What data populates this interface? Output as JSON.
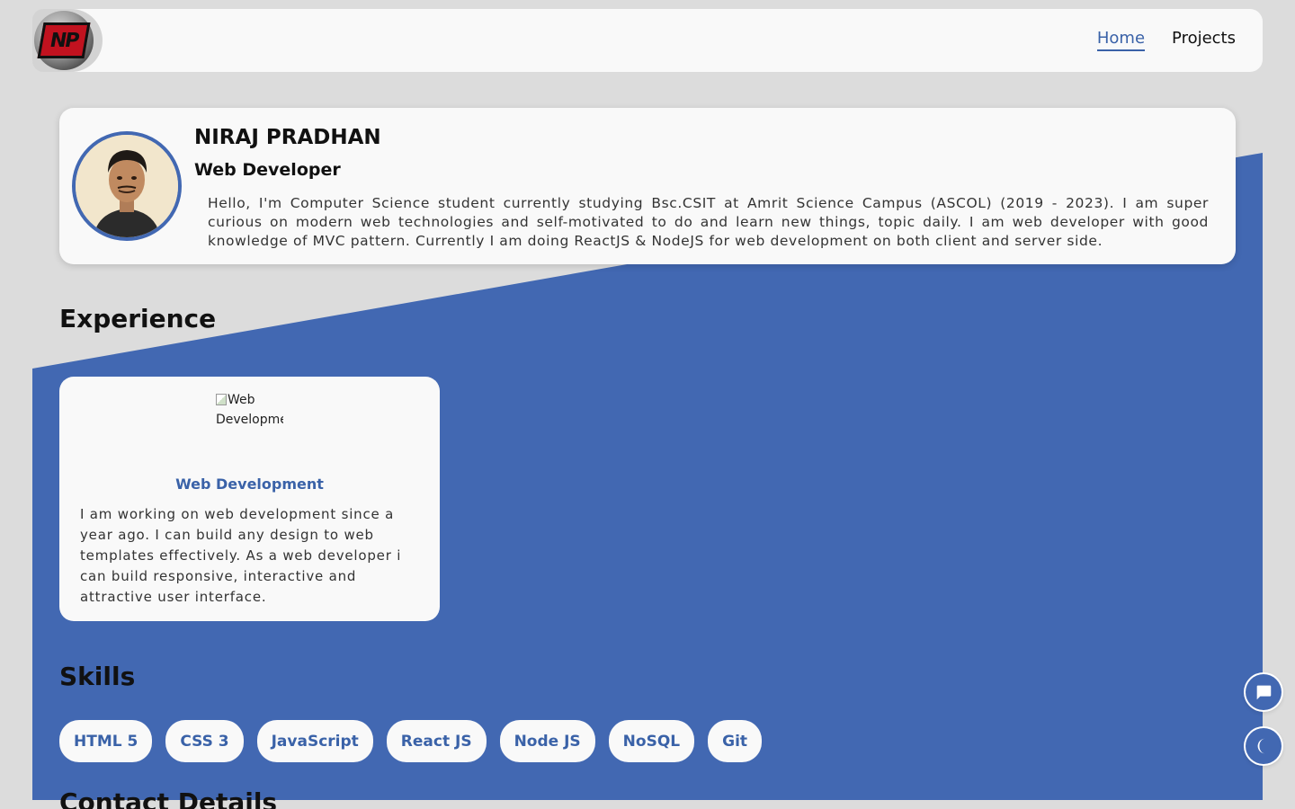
{
  "navbar": {
    "logo_text": "NP",
    "links": [
      {
        "label": "Home",
        "active": true
      },
      {
        "label": "Projects",
        "active": false
      }
    ]
  },
  "profile": {
    "name": "NIRAJ PRADHAN",
    "role": "Web Developer",
    "bio": "Hello, I'm Computer Science student currently studying Bsc.CSIT at Amrit Science Campus (ASCOL) (2019 - 2023). I am super curious on modern web technologies and self-motivated to do and learn new things, topic daily. I am web developer with good knowledge of MVC pattern. Currently I am doing ReactJS & NodeJS for web development on both client and server side."
  },
  "experience": {
    "title": "Experience",
    "items": [
      {
        "image_alt": "Web Development",
        "heading": "Web Development",
        "description": "I am working on web development since a year ago. I can build any design to web templates effectively. As a web developer i can build responsive, interactive and attractive user interface."
      }
    ]
  },
  "skills": {
    "title": "Skills",
    "items": [
      "HTML 5",
      "CSS 3",
      "JavaScript",
      "React JS",
      "Node JS",
      "NoSQL",
      "Git"
    ]
  },
  "contact": {
    "title": "Contact Details"
  },
  "floating": {
    "chat_icon": "chat-icon",
    "theme_icon": "moon-icon"
  },
  "colors": {
    "accent": "#4268b2",
    "link_active": "#3a62a8",
    "page_bg": "#dcdcdc",
    "card_bg": "#f9f9f9"
  }
}
